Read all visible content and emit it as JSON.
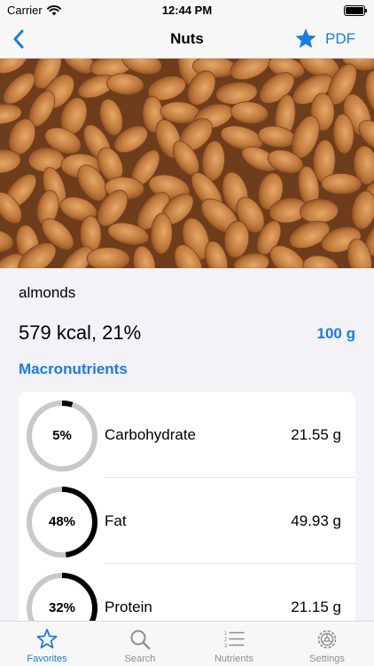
{
  "status_bar": {
    "carrier": "Carrier",
    "time": "12:44 PM"
  },
  "nav": {
    "title": "Nuts",
    "pdf_label": "PDF",
    "back_icon": "chevron-left-icon",
    "favorite_icon": "star-filled-icon"
  },
  "food": {
    "name": "almonds",
    "energy": "579 kcal, 21%",
    "portion": "100 g"
  },
  "macros": {
    "title": "Macronutrients",
    "items": [
      {
        "percent_label": "5%",
        "fraction": 0.05,
        "name": "Carbohydrate",
        "amount": "21.55 g"
      },
      {
        "percent_label": "48%",
        "fraction": 0.48,
        "name": "Fat",
        "amount": "49.93 g"
      },
      {
        "percent_label": "32%",
        "fraction": 0.32,
        "name": "Protein",
        "amount": "21.15 g"
      }
    ]
  },
  "tabs": [
    {
      "label": "Favorites",
      "icon": "star-outline-icon",
      "active": true
    },
    {
      "label": "Search",
      "icon": "magnifier-icon",
      "active": false
    },
    {
      "label": "Nutrients",
      "icon": "numbered-list-icon",
      "active": false
    },
    {
      "label": "Settings",
      "icon": "gear-icon",
      "active": false
    }
  ],
  "colors": {
    "accent": "#1A7CE8",
    "ring_track": "#C8C8C8",
    "ring_fill": "#000000",
    "background": "#F2F2F7",
    "almond": "#C9894C"
  }
}
